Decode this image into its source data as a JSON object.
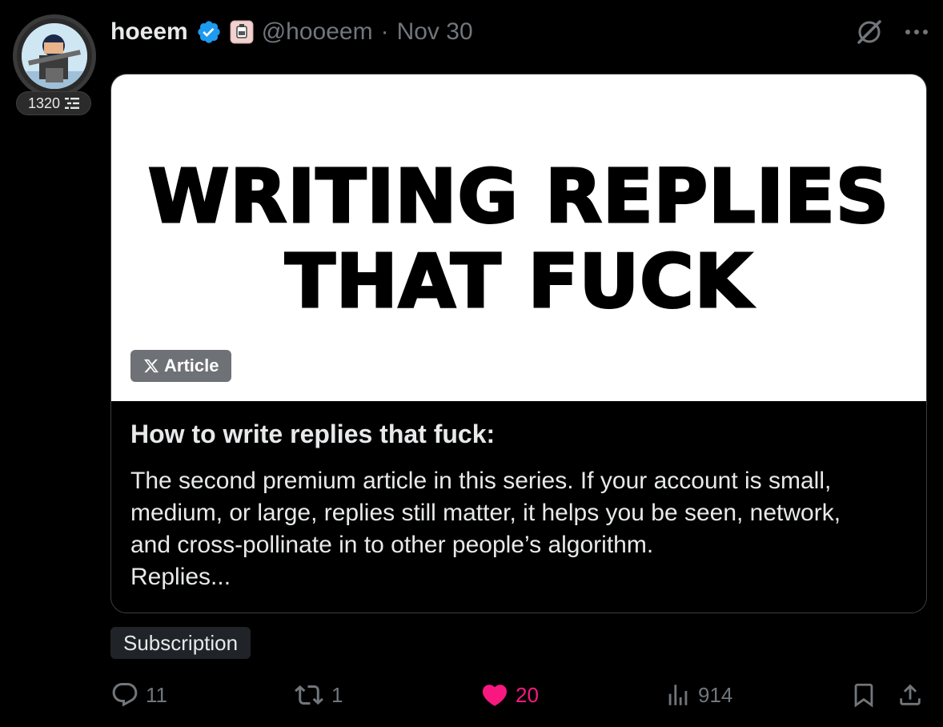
{
  "author": {
    "display_name": "hoeem",
    "handle": "@hooeem",
    "separator": "·",
    "date": "Nov 30",
    "level": "1320"
  },
  "card": {
    "image_headline": [
      "WRITING REPLIES",
      "THAT FUCK"
    ],
    "badge_label": "Article",
    "title": "How to write replies that fuck:",
    "description": [
      "The second premium article in this series. If your account is small,",
      "medium, or large, replies still matter, it helps you be seen, network,",
      "and cross-pollinate in to other people’s  algorithm.",
      "Replies..."
    ]
  },
  "subscription_label": "Subscription",
  "actions": {
    "replies": "11",
    "reposts": "1",
    "likes": "20",
    "views": "914"
  },
  "colors": {
    "background": "#000000",
    "text_primary": "#e7e9ea",
    "text_secondary": "#71767b",
    "verified": "#1d9bf0",
    "like": "#f91880"
  },
  "icons": {
    "verified": "verified-badge-icon",
    "affiliate": "affiliate-badge-icon",
    "grok": "grok-icon",
    "more": "more-icon",
    "reply": "reply-icon",
    "repost": "repost-icon",
    "like": "heart-icon",
    "views": "views-icon",
    "bookmark": "bookmark-icon",
    "share": "share-icon",
    "x_logo": "x-logo-icon",
    "level": "level-icon"
  }
}
